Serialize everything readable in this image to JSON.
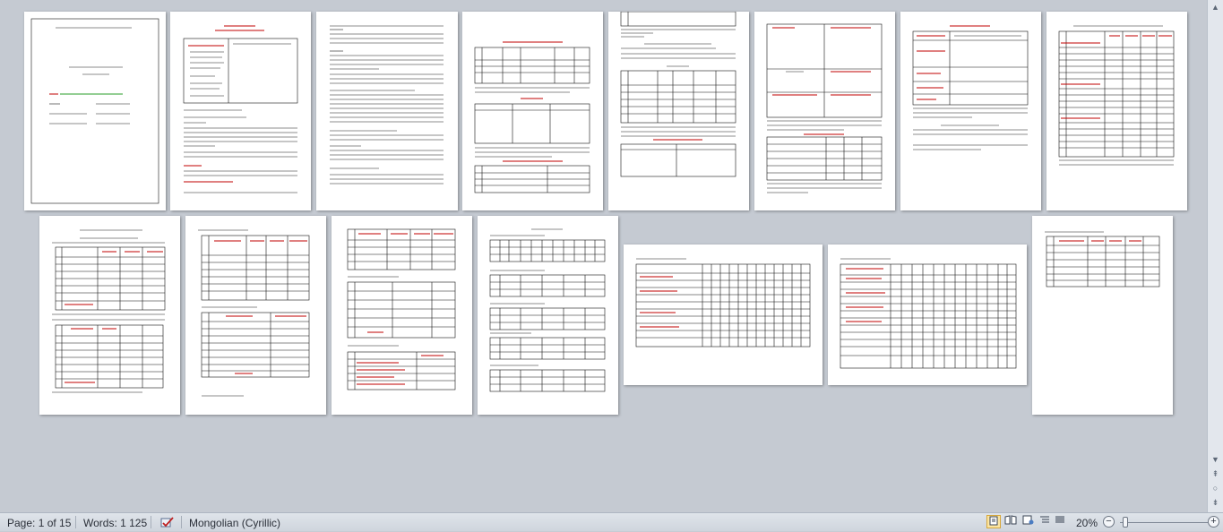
{
  "status_bar": {
    "page_info": "Page: 1 of 15",
    "words": "Words: 1 125",
    "language": "Mongolian (Cyrillic)",
    "zoom": "20%",
    "zoom_minus": "−",
    "zoom_plus": "+"
  },
  "icons": {
    "proofing": "proofing-check-icon",
    "print_layout": "print-layout-icon",
    "full_screen_reading": "full-screen-reading-icon",
    "web_layout": "web-layout-icon",
    "outline": "outline-icon",
    "draft": "draft-icon",
    "scroll_up": "scroll-up-arrow-icon",
    "scroll_down": "scroll-down-arrow-icon",
    "browse_prev": "browse-previous-icon",
    "browse_object": "browse-object-icon",
    "browse_next": "browse-next-icon"
  },
  "colors": {
    "workspace": "#c5cad2",
    "heading_red": "#c00000",
    "active_view": "#fbe5a3"
  },
  "document": {
    "total_pages": 15
  }
}
